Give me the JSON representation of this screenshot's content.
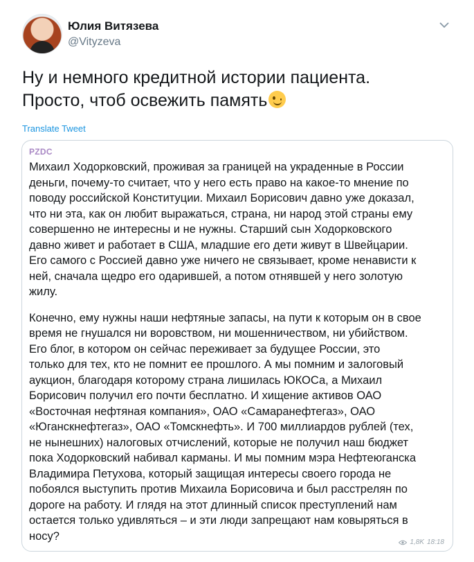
{
  "tweet": {
    "author": {
      "name": "Юлия Витязева",
      "handle": "@Vityzeva"
    },
    "text_lines": [
      "Ну и немного кредитной истории пациента.",
      "Просто, чтоб освежить память"
    ],
    "emoji": "winking-face",
    "translate_label": "Translate Tweet"
  },
  "quote": {
    "source": "PZDC",
    "paragraph1": [
      "Михаил Ходорковский, проживая за границей на украденные в России",
      "деньги, почему-то считает, что у него есть право на какое-то мнение по",
      "поводу российской Конституции. Михаил Борисович давно уже доказал,",
      "что ни эта, как он любит выражаться, страна, ни народ этой страны ему",
      "совершенно не интересны и не нужны. Старший сын Ходорковского",
      "давно живет и работает в США, младшие его дети живут в Швейцарии.",
      "Его самого с Россией давно уже ничего не связывает, кроме ненависти к",
      "ней, сначала щедро его одарившей, а потом отнявшей у него золотую",
      "жилу."
    ],
    "paragraph2": [
      "Конечно, ему нужны наши нефтяные запасы, на пути к которым он в свое",
      "время не гнушался ни воровством, ни мошенничеством, ни убийством.",
      "Его блог, в котором он сейчас переживает за будущее России, это",
      "только для тех, кто не помнит ее прошлого. А мы помним и залоговый",
      "аукцион, благодаря которому страна лишилась ЮКОСа, а Михаил",
      "Борисович получил его почти бесплатно. И хищение активов ОАО",
      "«Восточная нефтяная компания», ОАО «Самаранефтегаз», ОАО",
      "«Юганскнефтегаз», ОАО «Томскнефть». И 700 миллиардов рублей (тех,",
      "не нынешних) налоговых отчислений, которые не получил наш бюджет",
      "пока Ходорковский набивал карманы. И мы помним мэра Нефтеюганска",
      "Владимира Петухова, который защищая интересы своего города не",
      "побоялся выступить против Михаила Борисовича и был расстрелян по",
      "дороге на работу. И глядя на этот длинный список преступлений нам",
      "остается только удивляться – и эти люди запрещают нам ковыряться в",
      "носу?"
    ],
    "views": "1,8K",
    "time": "18:18"
  }
}
